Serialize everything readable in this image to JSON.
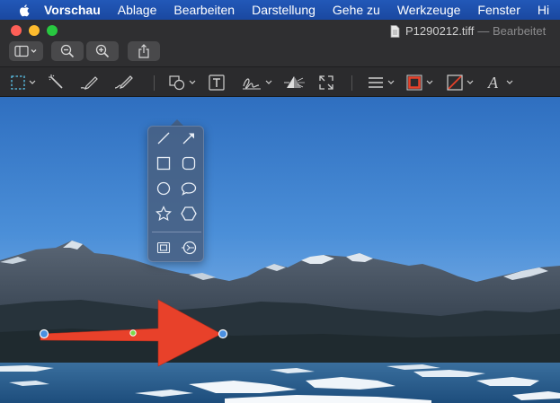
{
  "menubar": {
    "app": "Vorschau",
    "items": [
      "Ablage",
      "Bearbeiten",
      "Darstellung",
      "Gehe zu",
      "Werkzeuge",
      "Fenster",
      "Hi"
    ]
  },
  "window": {
    "title": "P1290212.tiff",
    "subtitle": "— Bearbeitet"
  },
  "colors": {
    "menubar": "#1f50ac",
    "arrow": "#e8412a",
    "border_tool": "#e8412a",
    "popover": "#486082"
  },
  "toolbar": {
    "buttons": [
      "sidebar-icon",
      "zoom-out-icon",
      "zoom-in-icon",
      "share-icon"
    ]
  },
  "markup": {
    "tools": [
      "rectangular-selection-icon",
      "instant-alpha-icon",
      "sketch-icon",
      "draw-icon",
      "shapes-icon",
      "text-icon",
      "sign-icon",
      "adjust-color-icon",
      "adjust-size-icon",
      "shape-style-icon",
      "border-color-icon",
      "fill-color-icon",
      "text-style-icon"
    ]
  },
  "shapes_popover": {
    "items": [
      "line-icon",
      "arrow-icon",
      "rectangle-icon",
      "rounded-rectangle-icon",
      "oval-icon",
      "speech-bubble-icon",
      "star-icon",
      "polygon-icon",
      "mask-icon",
      "loupe-icon"
    ]
  }
}
